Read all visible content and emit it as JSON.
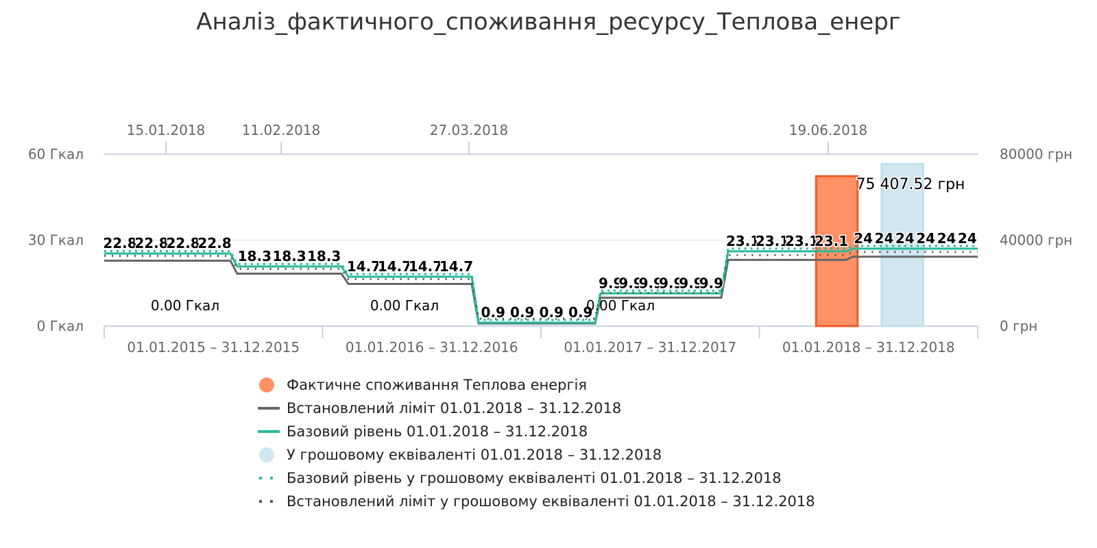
{
  "chart_data": {
    "type": "line",
    "title": "Аналіз_фактичного_споживання_ресурсу_Теплова_енерг",
    "left_axis": {
      "ticks": [
        "0 Гкал",
        "30 Гкал",
        "60 Гкал"
      ],
      "range": [
        0,
        60
      ],
      "unit": "Гкал"
    },
    "right_axis": {
      "ticks": [
        "0 грн",
        "40000 грн",
        "80000 грн"
      ],
      "range": [
        0,
        80000
      ],
      "unit": "грн"
    },
    "top_axis": {
      "ticks": [
        "15.01.2018",
        "11.02.2018",
        "27.03.2018",
        "19.06.2018"
      ]
    },
    "categories": [
      "01.01.2015 – 31.12.2015",
      "01.01.2016 – 31.12.2016",
      "01.01.2017 – 31.12.2017",
      "01.01.2018 – 31.12.2018"
    ],
    "segments": [
      {
        "category": 0,
        "level": "22.8",
        "labels": [
          "22.8",
          "22.8",
          "22.8",
          "22.8"
        ],
        "limit": 22.8,
        "base": 25.3,
        "money_base": 33600
      },
      {
        "category": 0,
        "level": "18.3",
        "labels": [
          "18.3",
          "18.3",
          "18.3"
        ],
        "limit": 18.3,
        "base": 20.8,
        "money_base": 27600
      },
      {
        "category": 1,
        "level": "14.7",
        "labels": [
          "14.7",
          "14.7",
          "14.7",
          "14.7"
        ],
        "limit": 14.7,
        "base": 17.2,
        "money_base": 22900
      },
      {
        "category": 1,
        "level": "0.9",
        "labels": [
          "0.9",
          "0.9",
          "0.9",
          "0.9"
        ],
        "limit": 0.9,
        "base": 1.2,
        "money_base": 1600
      },
      {
        "category": 2,
        "level": "9.9",
        "labels": [
          "9.9",
          "9.9",
          "9.9",
          "9.9",
          "9.9",
          "9.9"
        ],
        "limit": 9.9,
        "base": 11.4,
        "money_base": 15200
      },
      {
        "category": 2,
        "level": "23.1",
        "labels": [
          "23.1",
          "23.1",
          "23.1",
          "23.1"
        ],
        "limit": 23.1,
        "base": 26.1,
        "money_base": 34800
      },
      {
        "category": 3,
        "level": "24",
        "labels": [
          "24",
          "24",
          "24",
          "24",
          "24",
          "24"
        ],
        "limit": 24.2,
        "base": 27.0,
        "money_base": 36000
      }
    ],
    "zero_labels": [
      "0.00 Гкал",
      "0.00 Гкал",
      "0.00 Гкал"
    ],
    "bars": [
      {
        "series": "Фактичне споживання Теплова енергія",
        "value": 52.3,
        "unit": "Гкал"
      },
      {
        "series": "У грошовому еквіваленті 01.01.2018 – 31.12.2018",
        "value": 75407.52,
        "unit": "грн",
        "label": "75 407.52 грн"
      }
    ],
    "grid": true,
    "legend_position": "bottom"
  },
  "legend": [
    {
      "label": "Фактичне споживання Теплова енергія",
      "symbol": "circle",
      "color": "#FF9166",
      "border": "#F15A29"
    },
    {
      "label": "Встановлений ліміт 01.01.2018 – 31.12.2018",
      "symbol": "line",
      "color": "#666666"
    },
    {
      "label": "Базовий рівень 01.01.2018 – 31.12.2018",
      "symbol": "line",
      "color": "#26B99A"
    },
    {
      "label": "У грошовому еквіваленті 01.01.2018 – 31.12.2018",
      "symbol": "circle",
      "color": "#D0E7EF",
      "border": "#D0E7EF"
    },
    {
      "label": "Базовий рівень у грошовому еквіваленті 01.01.2018 – 31.12.2018",
      "symbol": "dots",
      "color": "#26B99A"
    },
    {
      "label": "Встановлений ліміт у грошовому еквіваленті 01.01.2018 – 31.12.2018",
      "symbol": "dots",
      "color": "#555555"
    }
  ],
  "colors": {
    "limit": "#666666",
    "base": "#26B99A",
    "actual_fill": "#FF9166",
    "actual_border": "#F15A29",
    "money_fill": "#D0E7EF",
    "money_border": "#BFE0EA",
    "grid": "#D8DEE8",
    "axis": "#C8D2E3"
  }
}
